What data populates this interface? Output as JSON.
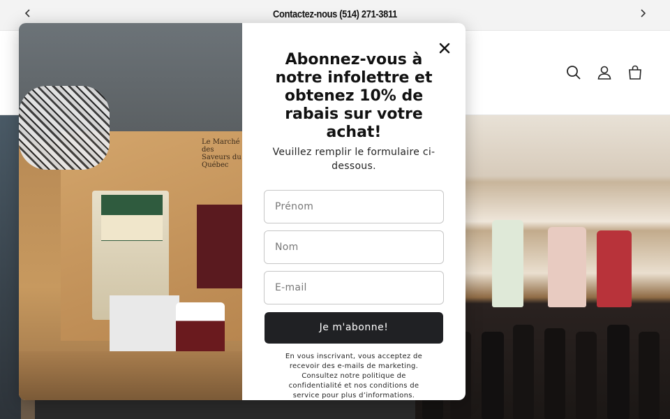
{
  "announcement": {
    "text": "Contactez-nous (514) 271-3811",
    "prev_icon": "chevron-left-icon",
    "next_icon": "chevron-right-icon"
  },
  "header": {
    "icons": [
      "search-icon",
      "account-icon",
      "cart-icon"
    ]
  },
  "popup": {
    "image_brand_text": "Le Marché des Saveurs du Québec",
    "title": "Abonnez-vous à notre infolettre et obtenez 10% de rabais sur votre achat!",
    "subtitle": "Veuillez remplir le formulaire ci-dessous.",
    "fields": {
      "first_name_placeholder": "Prénom",
      "last_name_placeholder": "Nom",
      "email_placeholder": "E-mail"
    },
    "submit_label": "Je m'abonne!",
    "legal": "En vous inscrivant, vous acceptez de recevoir des e-mails de marketing. Consultez notre politique de confidentialité et nos conditions de service pour plus d’informations."
  },
  "colors": {
    "button_bg": "#202124",
    "announcement_bg": "#f3f3f3"
  }
}
